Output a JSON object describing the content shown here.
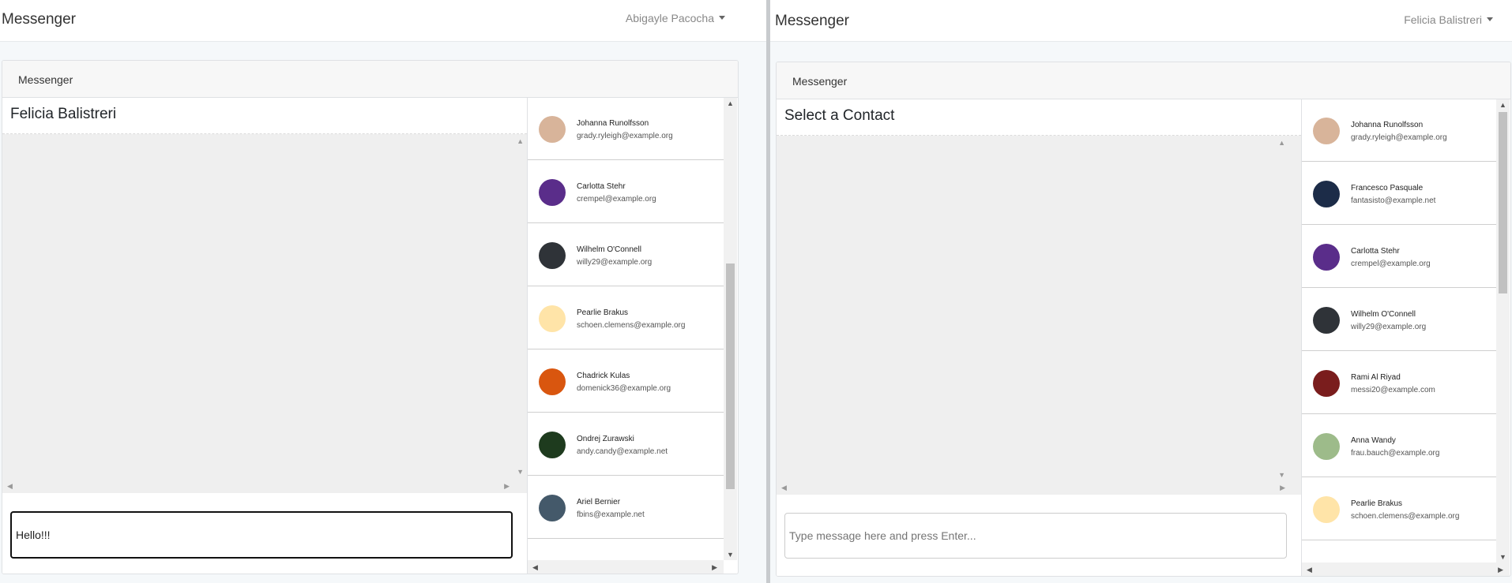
{
  "left": {
    "brand": "Messenger",
    "user": "Abigayle Pacocha",
    "card_title": "Messenger",
    "chat_title": "Felicia Balistreri",
    "compose_value": "Hello!!!",
    "contacts": [
      {
        "name": "Johanna Runolfsson",
        "email": "grady.ryleigh@example.org",
        "avatar": "#d8b49a"
      },
      {
        "name": "Carlotta Stehr",
        "email": "crempel@example.org",
        "avatar": "#5a2d8a"
      },
      {
        "name": "Wilhelm O'Connell",
        "email": "willy29@example.org",
        "avatar": "#2f3338"
      },
      {
        "name": "Pearlie Brakus",
        "email": "schoen.clemens@example.org",
        "avatar": "#ffe4a8"
      },
      {
        "name": "Chadrick Kulas",
        "email": "domenick36@example.org",
        "avatar": "#d9560f"
      },
      {
        "name": "Ondrej Zurawski",
        "email": "andy.candy@example.net",
        "avatar": "#1e3b1e"
      },
      {
        "name": "Ariel Bernier",
        "email": "fbins@example.net",
        "avatar": "#44596a"
      }
    ]
  },
  "right": {
    "brand": "Messenger",
    "user": "Felicia Balistreri",
    "card_title": "Messenger",
    "chat_title": "Select a Contact",
    "compose_placeholder": "Type message here and press Enter...",
    "contacts": [
      {
        "name": "Johanna Runolfsson",
        "email": "grady.ryleigh@example.org",
        "avatar": "#d8b49a"
      },
      {
        "name": "Francesco Pasquale",
        "email": "fantasisto@example.net",
        "avatar": "#1c2c48"
      },
      {
        "name": "Carlotta Stehr",
        "email": "crempel@example.org",
        "avatar": "#5a2d8a"
      },
      {
        "name": "Wilhelm O'Connell",
        "email": "willy29@example.org",
        "avatar": "#2f3338"
      },
      {
        "name": "Rami Al Riyad",
        "email": "messi20@example.com",
        "avatar": "#7a1d1d"
      },
      {
        "name": "Anna Wandy",
        "email": "frau.bauch@example.org",
        "avatar": "#9dbb8a"
      },
      {
        "name": "Pearlie Brakus",
        "email": "schoen.clemens@example.org",
        "avatar": "#ffe4a8"
      }
    ]
  }
}
